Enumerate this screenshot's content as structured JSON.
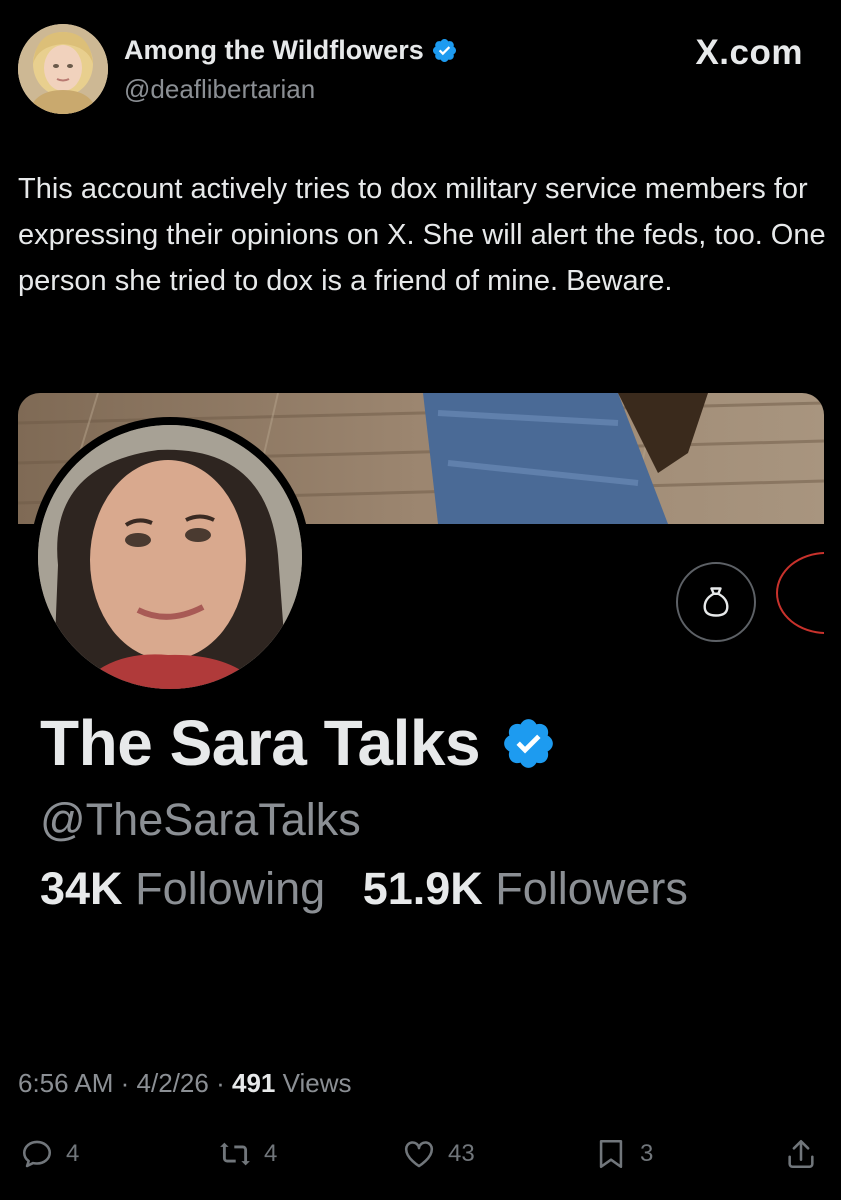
{
  "author": {
    "name": "Among the Wildflowers",
    "handle": "@deaflibertarian",
    "verified": true,
    "avatar_icon": "avatar-photo"
  },
  "brand": {
    "label": "X.com"
  },
  "tweet": {
    "text": "This account actively tries to dox military service members for expressing their opinions on X.  She will alert the feds, too. One person she tried to dox is a friend of mine. Beware."
  },
  "embedded_profile": {
    "name": "The Sara Talks",
    "handle": "@TheSaraTalks",
    "verified": true,
    "following_count": "34K",
    "following_label": "Following",
    "followers_count": "51.9K",
    "followers_label": "Followers",
    "action_icon": "money-bag-icon"
  },
  "meta": {
    "time": "6:56 AM",
    "date": "4/2/26",
    "views_count": "491",
    "views_label": "Views",
    "separator": "·"
  },
  "actions": {
    "replies": "4",
    "reposts": "4",
    "likes": "43",
    "bookmarks": "3"
  },
  "colors": {
    "background": "#000000",
    "text_primary": "#e7e9ea",
    "text_secondary": "#8b8f94",
    "verified_blue": "#1d9bf0",
    "accent_red": "#c8322c"
  }
}
